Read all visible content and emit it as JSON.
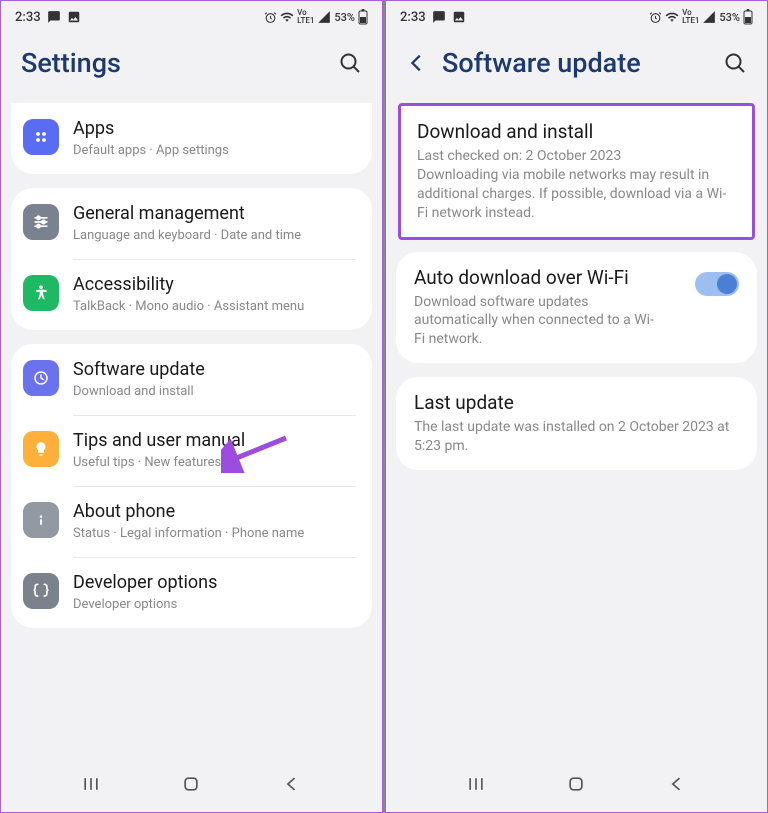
{
  "status": {
    "time": "2:33",
    "battery": "53%",
    "network": "Vo LTE1"
  },
  "left": {
    "title": "Settings",
    "groups": [
      {
        "partial_top": true,
        "items": [
          {
            "icon": "apps",
            "title": "Apps",
            "sub": "Default apps  ·  App settings"
          }
        ]
      },
      {
        "items": [
          {
            "icon": "general",
            "title": "General management",
            "sub": "Language and keyboard  ·  Date and time"
          },
          {
            "icon": "access",
            "title": "Accessibility",
            "sub": "TalkBack  ·  Mono audio  ·  Assistant menu"
          }
        ]
      },
      {
        "items": [
          {
            "icon": "software",
            "title": "Software update",
            "sub": "Download and install"
          },
          {
            "icon": "tips",
            "title": "Tips and user manual",
            "sub": "Useful tips  ·  New features"
          },
          {
            "icon": "about",
            "title": "About phone",
            "sub": "Status  ·  Legal information  ·  Phone name"
          },
          {
            "icon": "dev",
            "title": "Developer options",
            "sub": "Developer options"
          }
        ]
      }
    ]
  },
  "right": {
    "title": "Software update",
    "download": {
      "title": "Download and install",
      "line1": "Last checked on: 2 October 2023",
      "line2": "Downloading via mobile networks may result in additional charges. If possible, download via a Wi-Fi network instead."
    },
    "auto": {
      "title": "Auto download over Wi-Fi",
      "sub": "Download software updates automatically when connected to a Wi-Fi network.",
      "enabled": true
    },
    "last": {
      "title": "Last update",
      "sub": "The last update was installed on 2 October 2023 at 5:23 pm."
    }
  }
}
